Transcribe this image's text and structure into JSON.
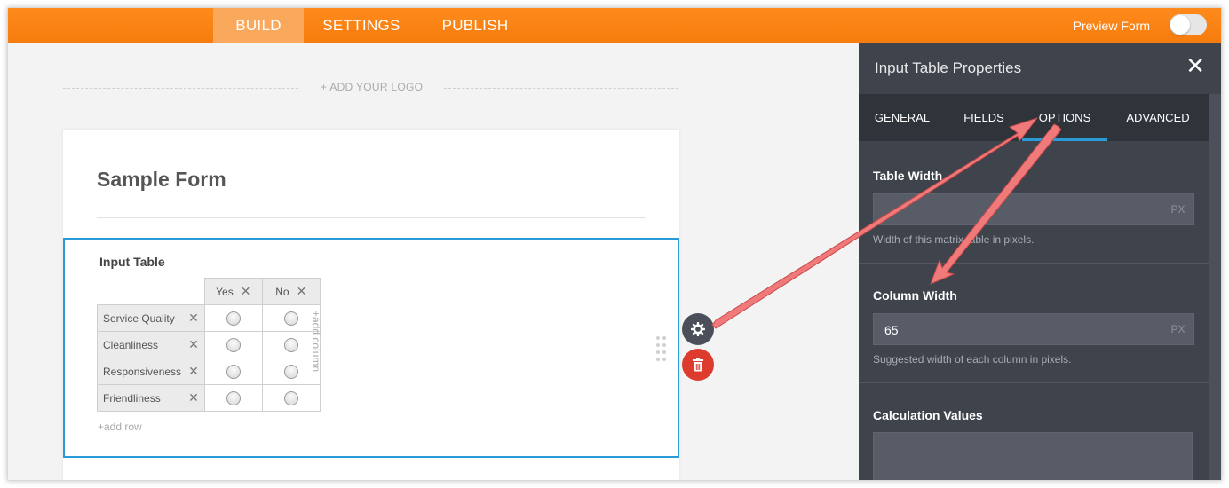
{
  "topbar": {
    "tabs": [
      {
        "label": "BUILD"
      },
      {
        "label": "SETTINGS"
      },
      {
        "label": "PUBLISH"
      }
    ],
    "preview_label": "Preview Form"
  },
  "logo": {
    "text": "+ ADD YOUR LOGO"
  },
  "form": {
    "title": "Sample Form",
    "field": {
      "label": "Input Table",
      "columns": [
        "Yes",
        "No"
      ],
      "rows": [
        "Service Quality",
        "Cleanliness",
        "Responsiveness",
        "Friendliness"
      ],
      "add_column": "+add column",
      "add_row": "+add row"
    }
  },
  "panel": {
    "title": "Input Table Properties",
    "tabs": [
      "GENERAL",
      "FIELDS",
      "OPTIONS",
      "ADVANCED"
    ],
    "active_tab": "OPTIONS",
    "table_width": {
      "label": "Table Width",
      "value": "",
      "unit": "PX",
      "help": "Width of this matrix table in pixels."
    },
    "column_width": {
      "label": "Column Width",
      "value": "65",
      "unit": "PX",
      "help": "Suggested width of each column in pixels."
    },
    "calculation_values": {
      "label": "Calculation Values"
    }
  },
  "colors": {
    "accent": "#f57c0d",
    "selected": "#2b9bd7",
    "panel": "#3e434c",
    "delete": "#dd3b2e",
    "annotation": "#f07a7a"
  },
  "icons": [
    "close-icon",
    "gear-icon",
    "trash-icon",
    "drag-handle-icon",
    "remove-x-icon"
  ]
}
